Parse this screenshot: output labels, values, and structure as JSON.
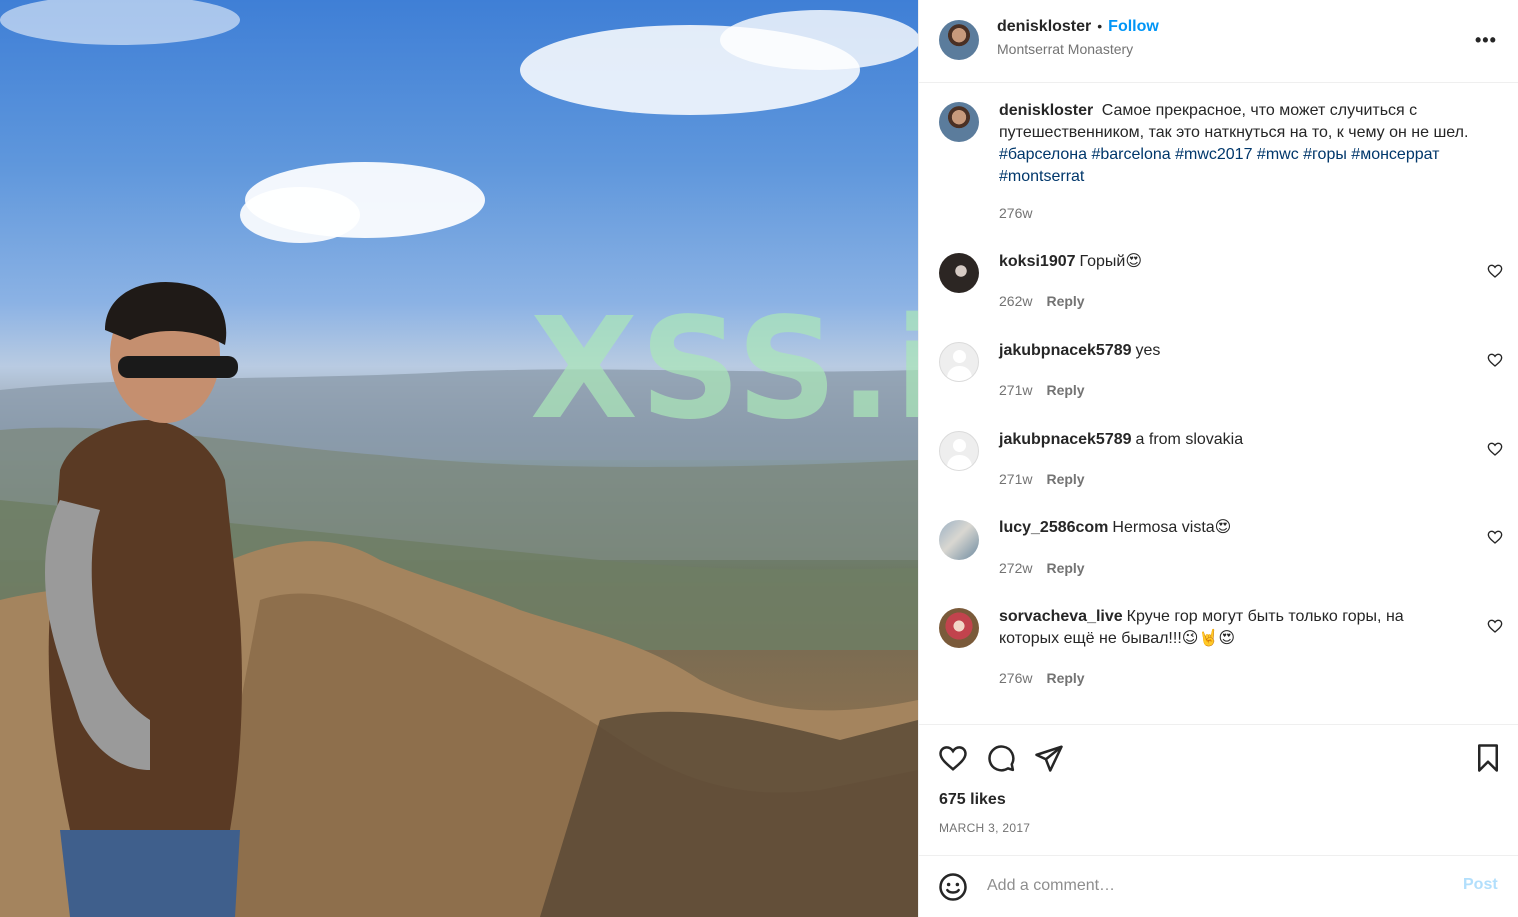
{
  "post": {
    "author": "deniskloster",
    "follow_label": "Follow",
    "location": "Montserrat Monastery",
    "more_label": "•••",
    "caption_prefix": "Самое прекрасное, что может случиться с путешественником, так это наткнуться на то, к чему он не шел.",
    "caption_tags": [
      "#барселона",
      "#barcelona",
      "#mwc2017",
      "#mwc",
      "#горы",
      "#монсеррат",
      "#montserrat"
    ],
    "caption_age": "276w",
    "likes": "675 likes",
    "date": "MARCH 3, 2017",
    "watermark": "XSS.is"
  },
  "comments": [
    {
      "user": "koksi1907",
      "text": "Горый😍",
      "age": "262w",
      "reply": "Reply",
      "avatar": "koksi"
    },
    {
      "user": "jakubpnacek5789",
      "text": "yes",
      "age": "271w",
      "reply": "Reply",
      "avatar": "blank"
    },
    {
      "user": "jakubpnacek5789",
      "text": "a from slovakia",
      "age": "271w",
      "reply": "Reply",
      "avatar": "blank"
    },
    {
      "user": "lucy_2586com",
      "text": "Hermosa vista😍",
      "age": "272w",
      "reply": "Reply",
      "avatar": "lucy"
    },
    {
      "user": "sorvacheva_live",
      "text": "Круче гор могут быть только горы, на которых ещё не бывал!!!😉🤘😍",
      "age": "276w",
      "reply": "Reply",
      "avatar": "sorv"
    }
  ],
  "add_comment": {
    "placeholder": "Add a comment…",
    "post_label": "Post"
  },
  "icons": {
    "like": "heart-icon",
    "comment": "comment-icon",
    "share": "share-icon",
    "save": "bookmark-icon",
    "emoji": "emoji-icon",
    "more": "more-icon"
  },
  "colors": {
    "follow": "#0095f6",
    "hashtag": "#00376b",
    "muted": "#737373",
    "post_disabled": "#b2dffc"
  }
}
